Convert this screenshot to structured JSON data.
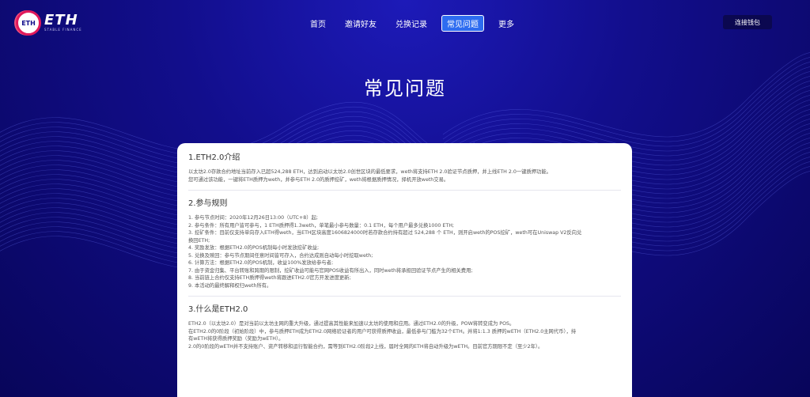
{
  "brand": {
    "ring_text": "ETH",
    "name": "ETH",
    "subtitle": "STABLE FINANCE"
  },
  "nav": {
    "items": [
      {
        "label": "首页",
        "active": false
      },
      {
        "label": "邀请好友",
        "active": false
      },
      {
        "label": "兑换记录",
        "active": false
      },
      {
        "label": "常见问题",
        "active": true
      },
      {
        "label": "更多",
        "active": false
      }
    ]
  },
  "connect_wallet": "连接钱包",
  "page_title": "常见问题",
  "sections": [
    {
      "title": "1.ETH2.0介绍",
      "lines": [
        "以太坊2.0存款合约地址当前存入已超524,288 ETH，达到启动以太坊2.0创世区块的最低要求，weth将支持ETH 2.0验证节点质押，并上线ETH 2.0一键质押功能。",
        "您可通过该功能，一键将ETH质押为weth，并参与ETH 2.0的质押挖矿，weth将根据质押情况，择机开放weth交易。"
      ]
    },
    {
      "title": "2.参与规则",
      "lines": [
        "1. 参与节点时间：2020年12月26日13:00（UTC+8）起;",
        "2. 参与条件：所有用户皆可参与，1 ETH质押得1.3weth，单笔最小参与数量：0.1 ETH，每个用户最多兑换1000 ETH;",
        "3. 挖矿条件：目前仅支持单向存入ETH得weth，当ETH区块高度1606824000时若存款合约持有超过 524,288 个 ETH，则开启weth的POS挖矿，weth可在Uniswap V2反向兑",
        "换回ETH;",
        "4. 奖励发放：根据ETH2.0的POS机制每小时发放挖矿收益;",
        "5. 兑换及赎回：参与节点期间任意时间皆可存入，合约达成则自动每小时挖取weth;",
        "6. 计算方法：根据ETH2.0的POS机制，收益100%发放给参与者;",
        "7. 由于资金归集、平台转账和跨期的限制，挖矿收益可能与官网POS收益有所出入，同时weth将承担回验证节点产生的相关费用;",
        "8. 当前链上合约仅支持ETH质押得weth将跟进ETH2.0官方开发进度更新;",
        "9. 本活动的最终解释权归weth所有。"
      ]
    },
    {
      "title": "3.什么是ETH2.0",
      "lines": [
        "ETH2.0（以太坊2.0）是对当前以太坊主网的重大升级，通过提高其性能来加速以太坊的使用和应用。通过ETH2.0的升级，POW将转变成为 POS。",
        "在ETH2.0的0阶段（初始阶段）中，参与质押ETH成为ETH2.0网络验证者的用户可获得质押收益，最低参与门槛为32个ETH。并将1:1.3 质押的wETH（ETH2.0主网代币），持",
        "有wETH将获得质押奖励（奖励为wETH）。",
        "2.0的0阶段的wETH并不支持账户、资产转移和运行智能合约，需等到ETH2.0阶段2上线，届时全网的ETH将自动升级为wETH。目前官方期限不定（至少2年）。"
      ]
    }
  ],
  "colors": {
    "background_top": "#1d1ab8",
    "background_bottom": "#08055a",
    "active_tab": "#2d6cf0",
    "logo_accent": "#e0195b",
    "connect_button": "#0b0850"
  }
}
